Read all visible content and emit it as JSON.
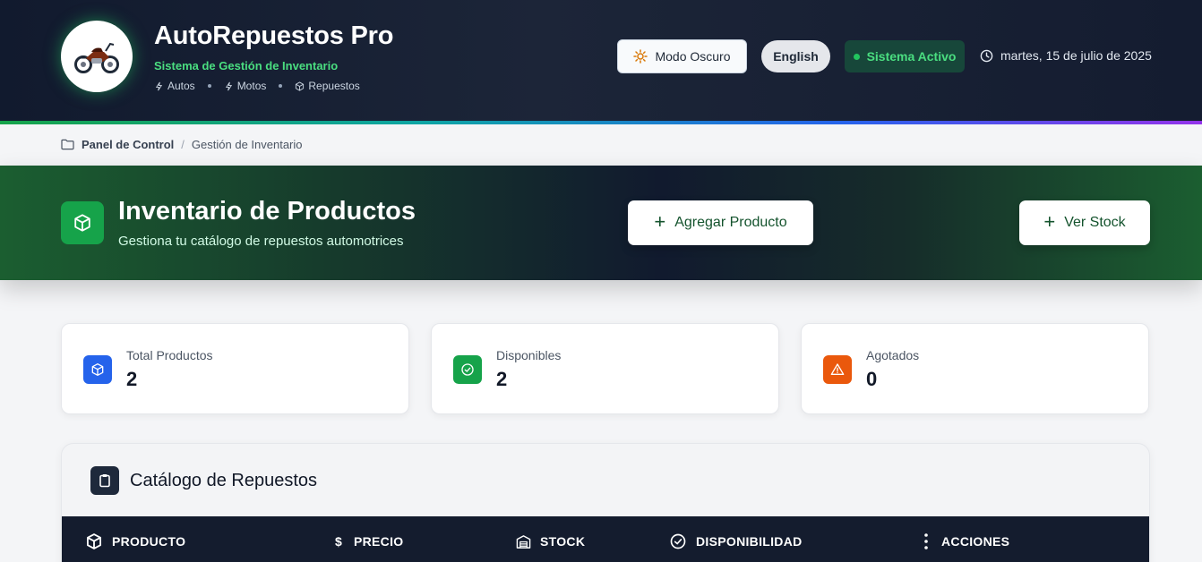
{
  "header": {
    "title": "AutoRepuestos Pro",
    "subtitle": "Sistema de Gestión de Inventario",
    "tags": [
      "Autos",
      "Motos",
      "Repuestos"
    ],
    "dark_mode_label": "Modo Oscuro",
    "language_label": "English",
    "status_label": "Sistema Activo",
    "date": "martes, 15 de julio de 2025"
  },
  "breadcrumb": {
    "home": "Panel de Control",
    "current": "Gestión de Inventario"
  },
  "hero": {
    "title": "Inventario de Productos",
    "subtitle": "Gestiona tu catálogo de repuestos automotrices",
    "add_button": "Agregar Producto",
    "stock_button": "Ver Stock"
  },
  "stats": [
    {
      "label": "Total Productos",
      "value": "2",
      "color": "#2563eb",
      "icon": "box-icon"
    },
    {
      "label": "Disponibles",
      "value": "2",
      "color": "#16a34a",
      "icon": "check-circle-icon"
    },
    {
      "label": "Agotados",
      "value": "0",
      "color": "#ea580c",
      "icon": "warning-icon"
    }
  ],
  "catalog": {
    "title": "Catálogo de Repuestos",
    "columns": [
      "PRODUCTO",
      "PRECIO",
      "STOCK",
      "DISPONIBILIDAD",
      "ACCIONES"
    ]
  },
  "colors": {
    "accent_green": "#16a34a",
    "header_bg": "#111a2e",
    "status_text": "#4ade80"
  }
}
